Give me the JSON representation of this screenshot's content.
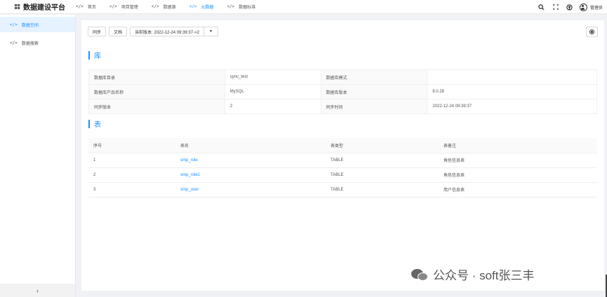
{
  "app": {
    "title": "数据建设平台"
  },
  "nav": [
    {
      "code": "</>",
      "label": "首页",
      "active": false
    },
    {
      "code": "</>",
      "label": "项目管理",
      "active": false
    },
    {
      "code": "</>",
      "label": "数据源",
      "active": false
    },
    {
      "code": "</>",
      "label": "元数据",
      "active": true
    },
    {
      "code": "</>",
      "label": "数据标准",
      "active": false
    }
  ],
  "user": {
    "name": "管理员"
  },
  "sidebar": {
    "items": [
      {
        "code": "</>",
        "label": "数据空间",
        "active": true
      },
      {
        "code": "</>",
        "label": "数据搜索",
        "active": false
      }
    ],
    "collapse": "‹"
  },
  "toolbar": {
    "sync": "同步",
    "docs": "文档",
    "version": "当前版本: 2022-12-24 09:39:37->2",
    "caret": "▼"
  },
  "db_section": {
    "title": "库",
    "rows": [
      [
        "数据库目录",
        "sync_test",
        "数据库模式",
        ""
      ],
      [
        "数据库产品名称",
        "MySQL",
        "数据库版本",
        "8.0.28"
      ],
      [
        "同步版本",
        "2",
        "同步时间",
        "2022-12-24 09:39:37"
      ]
    ]
  },
  "table_section": {
    "title": "表",
    "headers": [
      "序号",
      "表名",
      "表类型",
      "表备注"
    ],
    "rows": [
      [
        "1",
        "smp_role",
        "TABLE",
        "角色信息表"
      ],
      [
        "2",
        "smp_role1",
        "TABLE",
        "角色信息表"
      ],
      [
        "3",
        "smp_user",
        "TABLE",
        "用户信息表"
      ]
    ]
  },
  "watermark": {
    "text": "公众号 · soft张三丰"
  },
  "colors": {
    "accent": "#1890ff",
    "bg": "#f0f2f5"
  }
}
